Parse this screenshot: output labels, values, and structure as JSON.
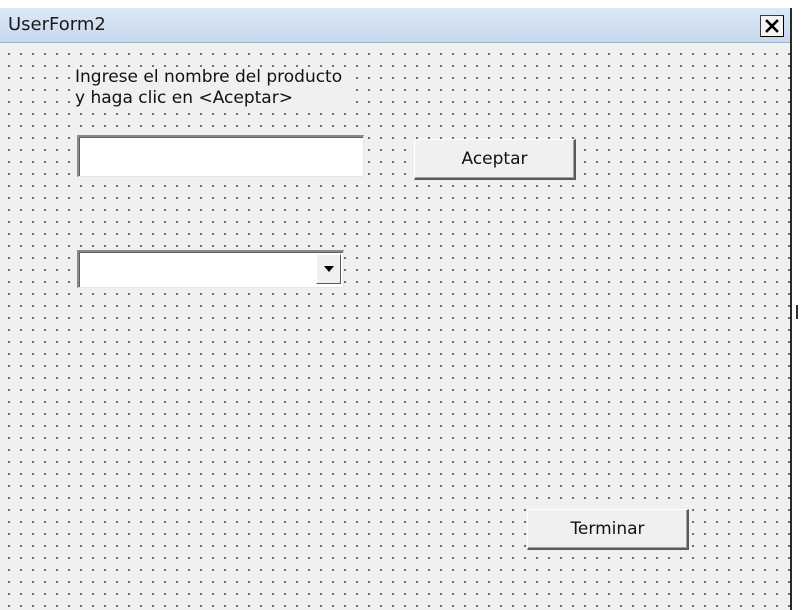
{
  "window": {
    "title": "UserForm2",
    "close_icon": "close-icon"
  },
  "form": {
    "label_line1": "Ingrese el nombre del producto",
    "label_line2": "y haga clic en <Aceptar>",
    "textbox_value": "",
    "combobox_value": "",
    "combobox_icon": "dropdown-arrow-icon",
    "accept_button_label": "Aceptar",
    "finish_button_label": "Terminar"
  },
  "colors": {
    "title_bar": "#c7d8ec",
    "form_background": "#f0f0f0",
    "grid_dots": "#555555"
  }
}
